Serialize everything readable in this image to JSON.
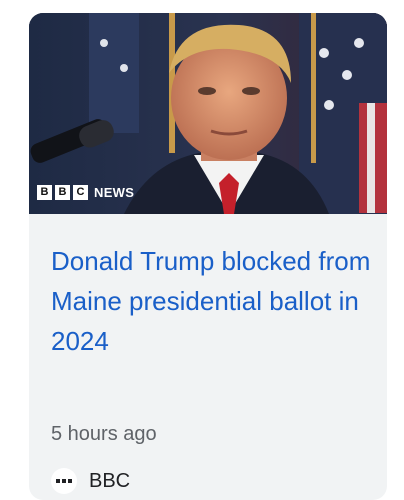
{
  "article": {
    "image": {
      "description_icon": "news-photo",
      "overlay_blocks": [
        "B",
        "B",
        "C"
      ],
      "overlay_text": "NEWS"
    },
    "headline": "Donald Trump blocked from Maine presidential ballot in 2024",
    "time": "5 hours ago",
    "publisher": {
      "name": "BBC",
      "icon": "bbc-logo-icon"
    },
    "colors": {
      "headline": "#1a5fc8",
      "card_background": "#f1f3f4",
      "meta_text": "#5f6368"
    }
  }
}
